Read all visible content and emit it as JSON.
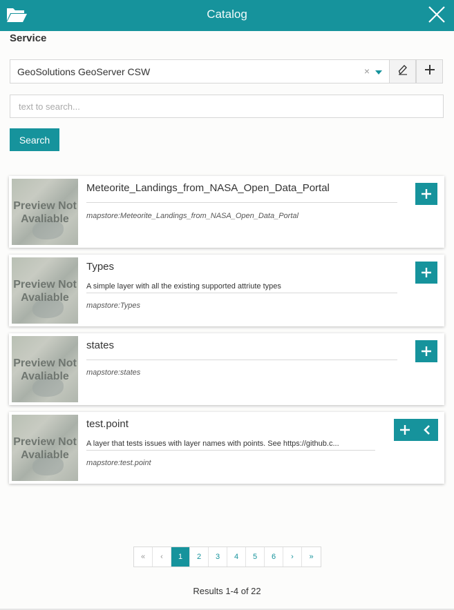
{
  "header": {
    "title": "Catalog"
  },
  "service": {
    "label": "Service",
    "selected": "GeoSolutions GeoServer CSW",
    "clear_symbol": "×",
    "edit_icon": "pencil-icon",
    "add_icon": "plus-icon"
  },
  "search": {
    "placeholder": "text to search...",
    "button_label": "Search"
  },
  "records": [
    {
      "title": "Meteorite_Landings_from_NASA_Open_Data_Portal",
      "description": "",
      "name": "mapstore:Meteorite_Landings_from_NASA_Open_Data_Portal",
      "thumb_text": "Preview Not Avaliable"
    },
    {
      "title": "Types",
      "description": "A simple layer with all the existing supported attriute types",
      "name": "mapstore:Types",
      "thumb_text": "Preview Not Avaliable"
    },
    {
      "title": "states",
      "description": "",
      "name": "mapstore:states",
      "thumb_text": "Preview Not Avaliable"
    },
    {
      "title": "test.point",
      "description": "A layer that tests issues with layer names with points. See https://github.c...",
      "name": "mapstore:test.point",
      "thumb_text": "Preview Not Avaliable"
    }
  ],
  "pagination": {
    "first": "«",
    "prev": "‹",
    "pages": [
      "1",
      "2",
      "3",
      "4",
      "5",
      "6"
    ],
    "active_page": "1",
    "next": "›",
    "last": "»"
  },
  "results_text": "Results 1-4 of 22",
  "colors": {
    "accent": "#16939c"
  }
}
